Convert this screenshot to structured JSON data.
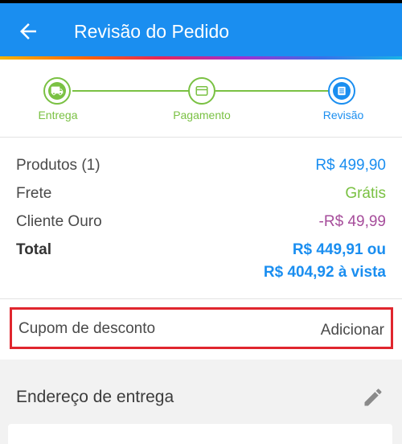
{
  "header": {
    "title": "Revisão do Pedido"
  },
  "colors": {
    "appbar": "#1a8ef0",
    "step_done": "#7ac143",
    "step_current": "#1a8ef0",
    "price_blue": "#1a8ef0",
    "free_green": "#7ac143",
    "discount_purple": "#a64d9b",
    "highlight_red": "#e0262e"
  },
  "steps": [
    {
      "label": "Entrega",
      "icon": "truck-icon"
    },
    {
      "label": "Pagamento",
      "icon": "credit-card-icon"
    },
    {
      "label": "Revisão",
      "icon": "list-icon"
    }
  ],
  "summary": {
    "products_label": "Produtos (1)",
    "products_value": "R$ 499,90",
    "shipping_label": "Frete",
    "shipping_value": "Grátis",
    "member_label": "Cliente Ouro",
    "member_value": "-R$ 49,99",
    "total_label": "Total",
    "total_value": "R$ 449,91 ou",
    "total_cash": "R$ 404,92 à vista"
  },
  "coupon": {
    "label": "Cupom de desconto",
    "action": "Adicionar"
  },
  "address": {
    "title": "Endereço de entrega"
  }
}
